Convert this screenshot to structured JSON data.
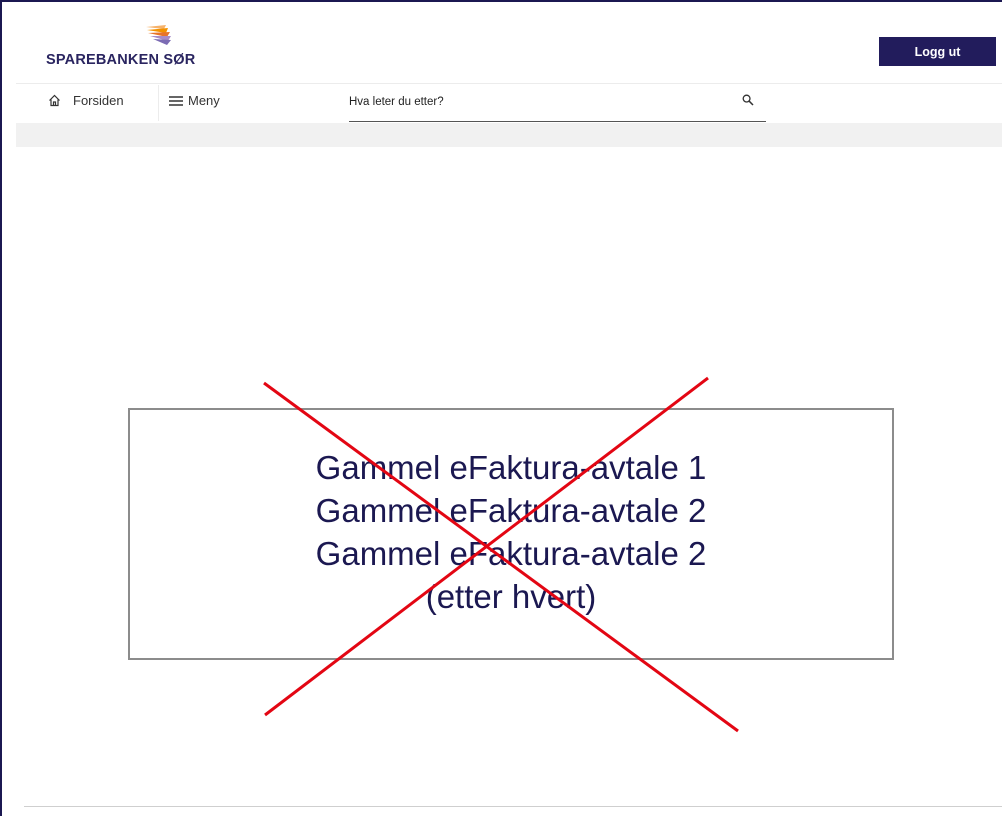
{
  "header": {
    "logo_text": "SPAREBANKEN SØR",
    "logout_label": "Logg ut"
  },
  "nav": {
    "home_label": "Forsiden",
    "menu_label": "Meny"
  },
  "search": {
    "placeholder": "Hva leter du etter?"
  },
  "overlay": {
    "lines": [
      "Gammel eFaktura-avtale 1",
      "Gammel eFaktura-avtale 2",
      "Gammel eFaktura-avtale 2",
      "(etter hvert)"
    ],
    "struck_through": true
  },
  "colors": {
    "brand_navy": "#221c5c",
    "cross_red": "#e30613",
    "logo_orange": "#f39200",
    "logo_purple": "#7b6bb3"
  }
}
